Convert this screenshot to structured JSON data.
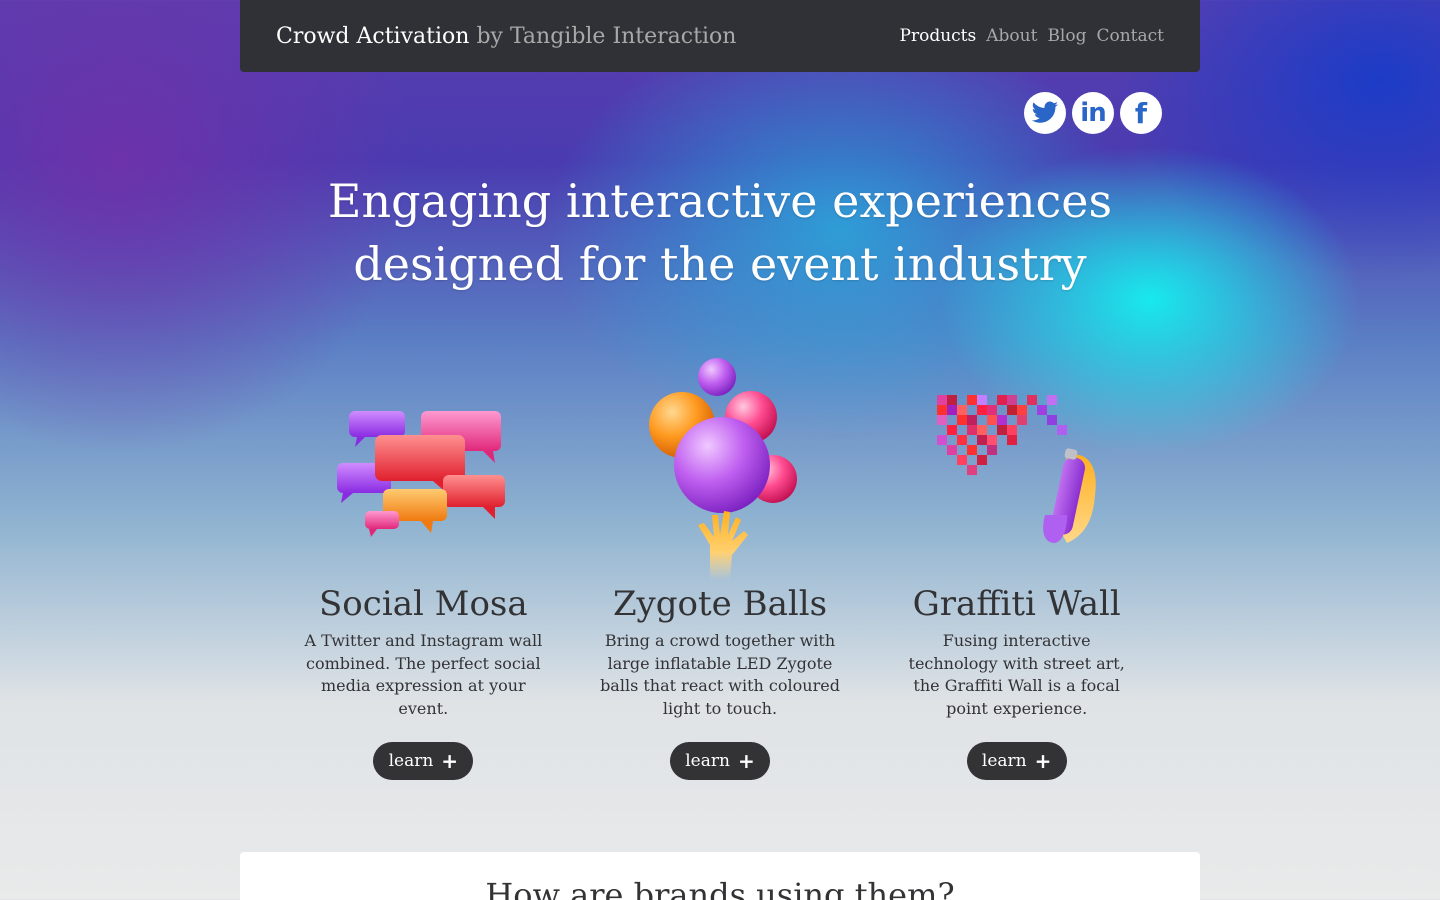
{
  "header": {
    "brand_name": "Crowd Activation",
    "brand_by": "by Tangible Interaction",
    "nav": [
      {
        "label": "Products",
        "active": true
      },
      {
        "label": "About",
        "active": false
      },
      {
        "label": "Blog",
        "active": false
      },
      {
        "label": "Contact",
        "active": false
      }
    ]
  },
  "social": {
    "twitter_icon": "twitter-bird-icon",
    "linkedin_label": "in",
    "facebook_label": "f"
  },
  "hero": {
    "line1": "Engaging interactive experiences",
    "line2": "designed for the event industry"
  },
  "products": [
    {
      "title": "Social Mosa",
      "description": "A Twitter and Instagram wall combined. The perfect social media expression at your event.",
      "button_label": "learn",
      "icon": "speech-bubbles-icon"
    },
    {
      "title": "Zygote Balls",
      "description": "Bring a crowd together with large inflatable LED Zygote balls that react with coloured light to touch.",
      "button_label": "learn",
      "icon": "balls-hand-icon"
    },
    {
      "title": "Graffiti Wall",
      "description": "Fusing interactive technology with street art, the Graffiti Wall is a focal point experience.",
      "button_label": "learn",
      "icon": "spray-can-pixels-icon"
    }
  ],
  "brands_section": {
    "heading": "How are brands using them?"
  },
  "colors": {
    "header_bg": "#2f3136",
    "text_dark": "#333336",
    "social_blue": "#2a66c8",
    "button_bg": "#333336"
  }
}
